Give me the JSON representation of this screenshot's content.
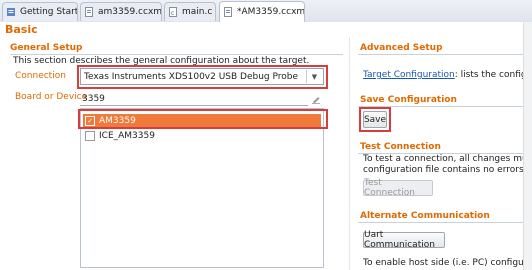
{
  "tabs": [
    {
      "label": "Getting Started",
      "icon": "getting-started-icon",
      "active": false,
      "closable": false
    },
    {
      "label": "am3359.ccxml",
      "icon": "ccxml-file-icon",
      "active": false,
      "closable": false
    },
    {
      "label": "main.c",
      "icon": "c-file-icon",
      "active": false,
      "closable": false
    },
    {
      "label": "*AM3359.ccxml",
      "icon": "ccxml-file-icon",
      "active": true,
      "closable": true
    }
  ],
  "page_title": "Basic",
  "general_setup": {
    "title": "General Setup",
    "description": "This section describes the general configuration about the target.",
    "connection_label": "Connection",
    "connection_value": "Texas Instruments XDS100v2 USB Debug Probe",
    "board_label": "Board or Device",
    "board_filter_value": "3359",
    "devices": [
      {
        "label": "AM3359",
        "checked": true,
        "selected": true
      },
      {
        "label": "ICE_AM3359",
        "checked": false,
        "selected": false
      }
    ]
  },
  "advanced_setup": {
    "title": "Advanced Setup",
    "link_text": "Target Configuration",
    "trailing_text": ": lists the configurati"
  },
  "save_configuration": {
    "title": "Save Configuration",
    "save_label": "Save"
  },
  "test_connection": {
    "title": "Test Connection",
    "line1": "To test a connection, all changes must hav",
    "line2": "configuration file contains no errors and th",
    "button_label": "Test Connection"
  },
  "alternate_communication": {
    "title": "Alternate Communication",
    "button_label": "Uart Communication",
    "bottom_text": "To enable host side (i.e. PC) configuration"
  },
  "colors": {
    "section_title": "#e06a00",
    "selection": "#f07a3c",
    "highlight_box": "#d93c3c",
    "link": "#1a56b0"
  }
}
